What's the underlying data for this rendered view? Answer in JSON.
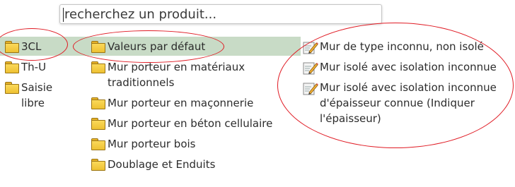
{
  "search": {
    "placeholder": "recherchez un produit..."
  },
  "categories": [
    {
      "label": "3CL",
      "icon": "folder-icon",
      "selected": true
    },
    {
      "label": "Th-U",
      "icon": "folder-icon"
    },
    {
      "label": "Saisie libre",
      "icon": "folder-icon"
    }
  ],
  "subcategories": [
    {
      "label": "Valeurs par défaut",
      "icon": "folder-icon",
      "selected": true
    },
    {
      "label": "Mur porteur en matériaux traditionnels",
      "icon": "folder-icon"
    },
    {
      "label": "Mur porteur en maçonnerie",
      "icon": "folder-icon"
    },
    {
      "label": "Mur porteur en béton cellulaire",
      "icon": "folder-icon"
    },
    {
      "label": "Mur porteur bois",
      "icon": "folder-icon"
    },
    {
      "label": "Doublage et Enduits",
      "icon": "folder-icon"
    }
  ],
  "products": [
    {
      "label": "Mur de type inconnu, non isolé",
      "icon": "edit-icon"
    },
    {
      "label": "Mur isolé avec isolation inconnue",
      "icon": "edit-icon"
    },
    {
      "label": "Mur isolé avec isolation inconnue d'épaisseur connue (Indiquer l'épaisseur)",
      "icon": "edit-icon"
    }
  ],
  "colors": {
    "selection": "#c8dbc6",
    "annotation": "#e01b24",
    "folder": "#f5c842"
  }
}
